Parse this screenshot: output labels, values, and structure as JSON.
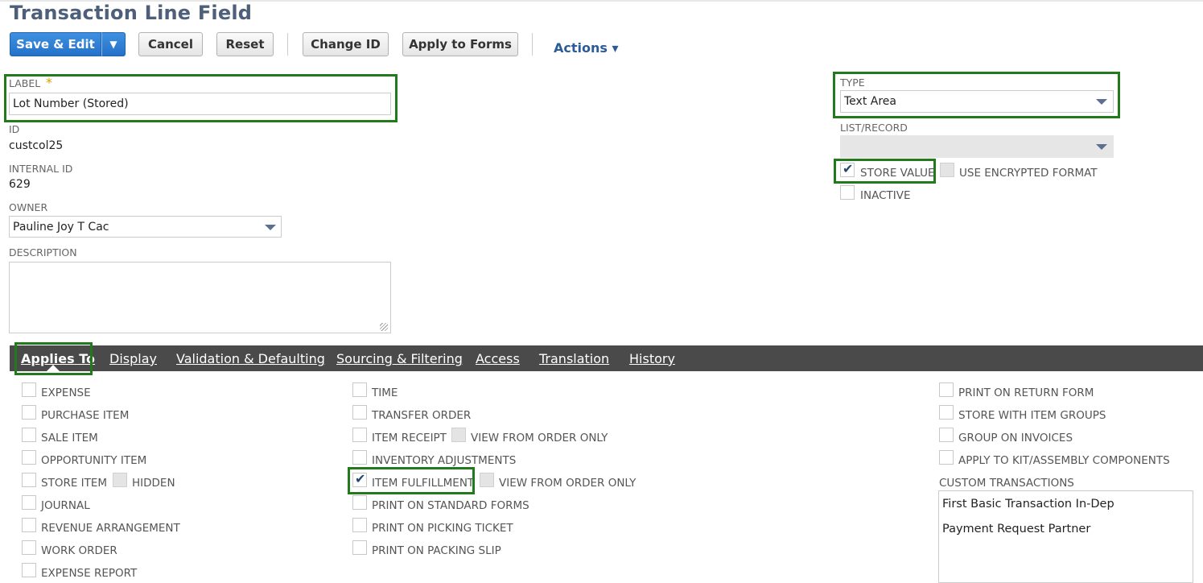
{
  "header": {
    "title": "Transaction Line Field"
  },
  "toolbar": {
    "save_edit": "Save & Edit",
    "dropdown_glyph": "▼",
    "cancel": "Cancel",
    "reset": "Reset",
    "change_id": "Change ID",
    "apply_to_forms": "Apply to Forms",
    "actions": "Actions ▾"
  },
  "form": {
    "label": {
      "label": "LABEL",
      "required_mark": "*",
      "value": "Lot Number (Stored)"
    },
    "id": {
      "label": "ID",
      "value": "custcol25"
    },
    "internal_id": {
      "label": "INTERNAL ID",
      "value": "629"
    },
    "owner": {
      "label": "OWNER",
      "value": "Pauline Joy T Cac"
    },
    "description": {
      "label": "DESCRIPTION",
      "value": ""
    },
    "type": {
      "label": "TYPE",
      "value": "Text Area"
    },
    "list_record": {
      "label": "LIST/RECORD",
      "value": ""
    },
    "store_value": {
      "label": "STORE VALUE",
      "checked": true
    },
    "use_encrypted_format": {
      "label": "USE ENCRYPTED FORMAT",
      "checked": false
    },
    "inactive": {
      "label": "INACTIVE",
      "checked": false
    }
  },
  "tabs": [
    {
      "label": "Applies To",
      "active": true
    },
    {
      "label": "Display"
    },
    {
      "label": "Validation & Defaulting"
    },
    {
      "label": "Sourcing & Filtering"
    },
    {
      "label": "Access"
    },
    {
      "label": "Translation"
    },
    {
      "label": "History"
    }
  ],
  "applies_to": {
    "col1": [
      "EXPENSE",
      "PURCHASE ITEM",
      "SALE ITEM",
      "OPPORTUNITY ITEM",
      "STORE ITEM",
      "JOURNAL",
      "REVENUE ARRANGEMENT",
      "WORK ORDER",
      "EXPENSE REPORT"
    ],
    "hidden": "HIDDEN",
    "col2": [
      "TIME",
      "TRANSFER ORDER",
      "ITEM RECEIPT",
      "INVENTORY ADJUSTMENTS",
      "ITEM FULFILLMENT",
      "PRINT ON STANDARD FORMS",
      "PRINT ON PICKING TICKET",
      "PRINT ON PACKING SLIP"
    ],
    "view_from_order_only": "VIEW FROM ORDER ONLY",
    "item_fulfillment_checked": true,
    "col3": [
      "PRINT ON RETURN FORM",
      "STORE WITH ITEM GROUPS",
      "GROUP ON INVOICES",
      "APPLY TO KIT/ASSEMBLY COMPONENTS"
    ],
    "custom_transactions": {
      "label": "CUSTOM TRANSACTIONS",
      "items": [
        "First Basic Transaction In-Dep",
        "Payment Request Partner"
      ]
    }
  },
  "colors": {
    "highlight": "#227a1d",
    "primary": "#2a7ad0",
    "tabbar": "#4a4a4a"
  }
}
